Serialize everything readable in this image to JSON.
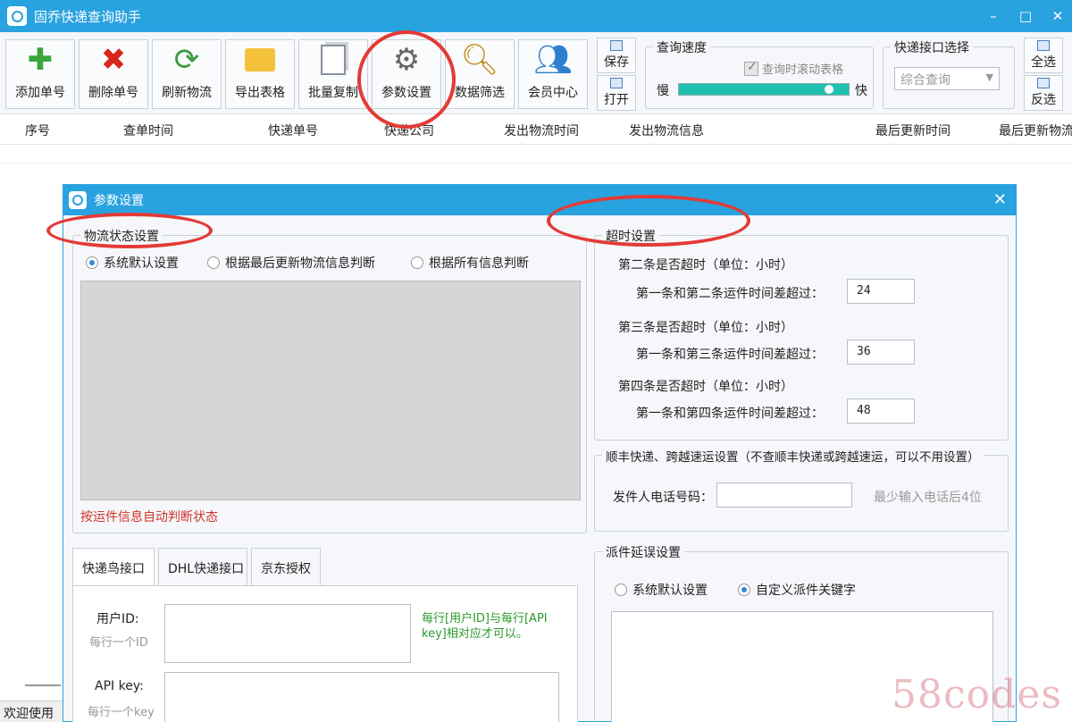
{
  "app": {
    "title": "固乔快递查询助手",
    "window_controls": [
      "–",
      "□",
      "✕"
    ]
  },
  "toolbar": {
    "buttons": [
      {
        "label": "添加单号",
        "icon": "plus-icon"
      },
      {
        "label": "删除单号",
        "icon": "delete-x-icon"
      },
      {
        "label": "刷新物流",
        "icon": "refresh-icon"
      },
      {
        "label": "导出表格",
        "icon": "folder-export-icon"
      },
      {
        "label": "批量复制",
        "icon": "copy-icon"
      },
      {
        "label": "参数设置",
        "icon": "gear-icon"
      },
      {
        "label": "数据筛选",
        "icon": "magnifier-icon"
      },
      {
        "label": "会员中心",
        "icon": "users-icon"
      }
    ],
    "save_label": "保存",
    "open_label": "打开",
    "speed": {
      "title": "查询速度",
      "scroll_checkbox": "查询时滚动表格",
      "scroll_checked": true,
      "slow_label": "慢",
      "fast_label": "快",
      "level": 0.92
    },
    "api_select": {
      "title": "快递接口选择",
      "value": "综合查询"
    },
    "select_all_label": "全选",
    "invert_label": "反选"
  },
  "table": {
    "columns": [
      "序号",
      "查单时间",
      "快递单号",
      "快递公司",
      "发出物流时间",
      "发出物流信息",
      "最后更新时间",
      "最后更新物流"
    ]
  },
  "status": {
    "text": "欢迎使用"
  },
  "dialog": {
    "title": "参数设置",
    "close": "✕",
    "logistics_status": {
      "title": "物流状态设置",
      "options": [
        "系统默认设置",
        "根据最后更新物流信息判断",
        "根据所有信息判断"
      ],
      "selected": 0,
      "hint": "按运件信息自动判断状态"
    },
    "timeout": {
      "title": "超时设置",
      "rules": [
        {
          "heading": "第二条是否超时（单位：小时）",
          "label": "第一条和第二条运件时间差超过：",
          "value": "24"
        },
        {
          "heading": "第三条是否超时（单位：小时）",
          "label": "第一条和第三条运件时间差超过：",
          "value": "36"
        },
        {
          "heading": "第四条是否超时（单位：小时）",
          "label": "第一条和第四条运件时间差超过：",
          "value": "48"
        }
      ]
    },
    "sf": {
      "title": "顺丰快递、跨越速运设置（不查顺丰快递或跨越速运，可以不用设置）",
      "phone_label": "发件人电话号码：",
      "phone_value": "",
      "phone_hint": "最少输入电话后4位"
    },
    "tabs": [
      "快递鸟接口",
      "DHL快递接口",
      "京东授权"
    ],
    "active_tab": 0,
    "kdn": {
      "user_id_label": "用户ID:",
      "user_id_sub": "每行一个ID",
      "api_key_label": "API key:",
      "api_key_sub": "每行一个key",
      "note": "每行[用户ID]与每行[API key]相对应才可以。"
    },
    "delay": {
      "title": "派件延误设置",
      "options": [
        "系统默认设置",
        "自定义派件关键字"
      ],
      "selected": 1
    }
  },
  "watermark": "58codes"
}
